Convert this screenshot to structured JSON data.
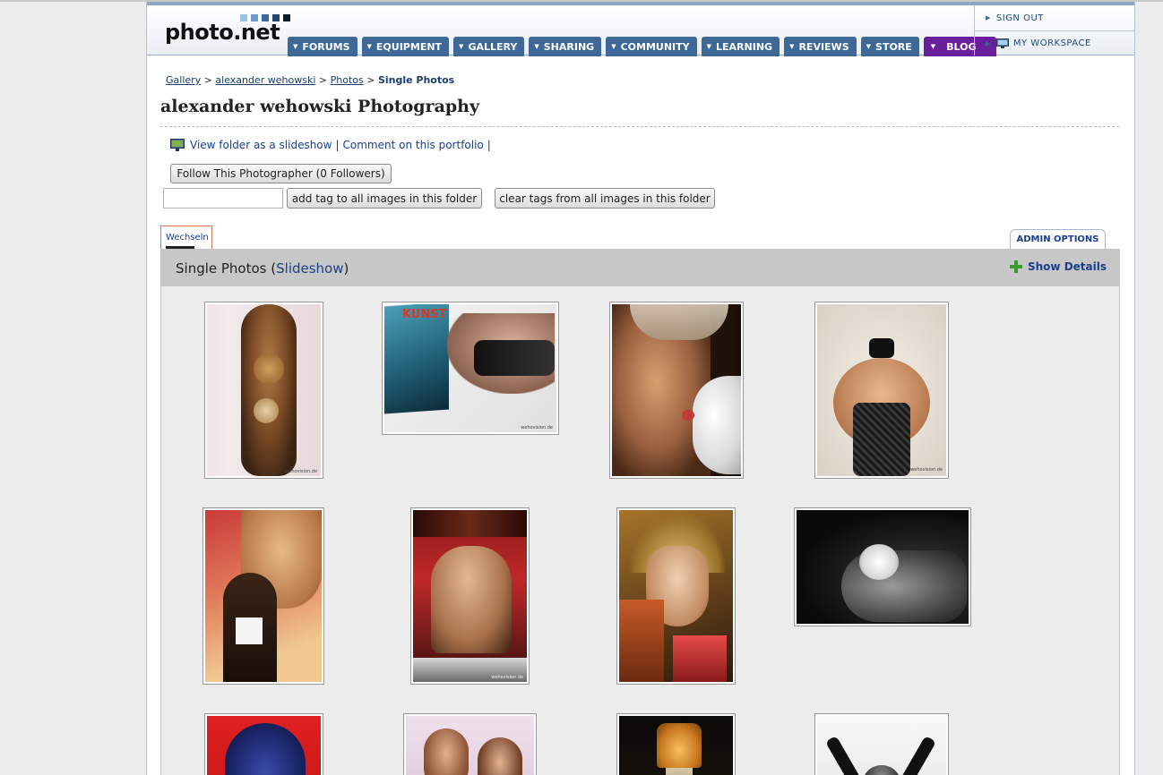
{
  "logo": {
    "text": "photo.net"
  },
  "nav": {
    "tabs": [
      {
        "label": "FORUMS"
      },
      {
        "label": "EQUIPMENT"
      },
      {
        "label": "GALLERY"
      },
      {
        "label": "SHARING"
      },
      {
        "label": "COMMUNITY"
      },
      {
        "label": "LEARNING"
      },
      {
        "label": "REVIEWS"
      },
      {
        "label": "STORE"
      },
      {
        "label": "BLOG"
      }
    ]
  },
  "usermenu": {
    "sign_out": "SIGN OUT",
    "workspace": "MY WORKSPACE"
  },
  "breadcrumb": {
    "gallery": "Gallery",
    "user": "alexander wehowski",
    "photos": "Photos",
    "current": "Single Photos",
    "sep": ">"
  },
  "page_title": "alexander wehowski Photography",
  "actions": {
    "slideshow": "View folder as a slideshow",
    "comment": "Comment on this portfolio",
    "sep": "|"
  },
  "buttons": {
    "follow": "Follow This Photographer (0 Followers)",
    "add_tag": "add tag to all images in this folder",
    "clear_tags": "clear tags from all images in this folder"
  },
  "tabs": {
    "wechseln": "Wechseln",
    "admin": "ADMIN OPTIONS"
  },
  "folder": {
    "title": "Single Photos",
    "slideshow_link": "Slideshow",
    "open": "(",
    "close": ")",
    "show_details": "Show Details"
  },
  "watermarks": {
    "w1": "wehovision.de",
    "w2": "wehovision.de",
    "w3": "wehovision.de",
    "w4": "wehovision.de"
  },
  "colors": {
    "nav_blue": "#3e6897",
    "blog_purple": "#6a1f9a",
    "link_blue": "#1a3f8a"
  }
}
